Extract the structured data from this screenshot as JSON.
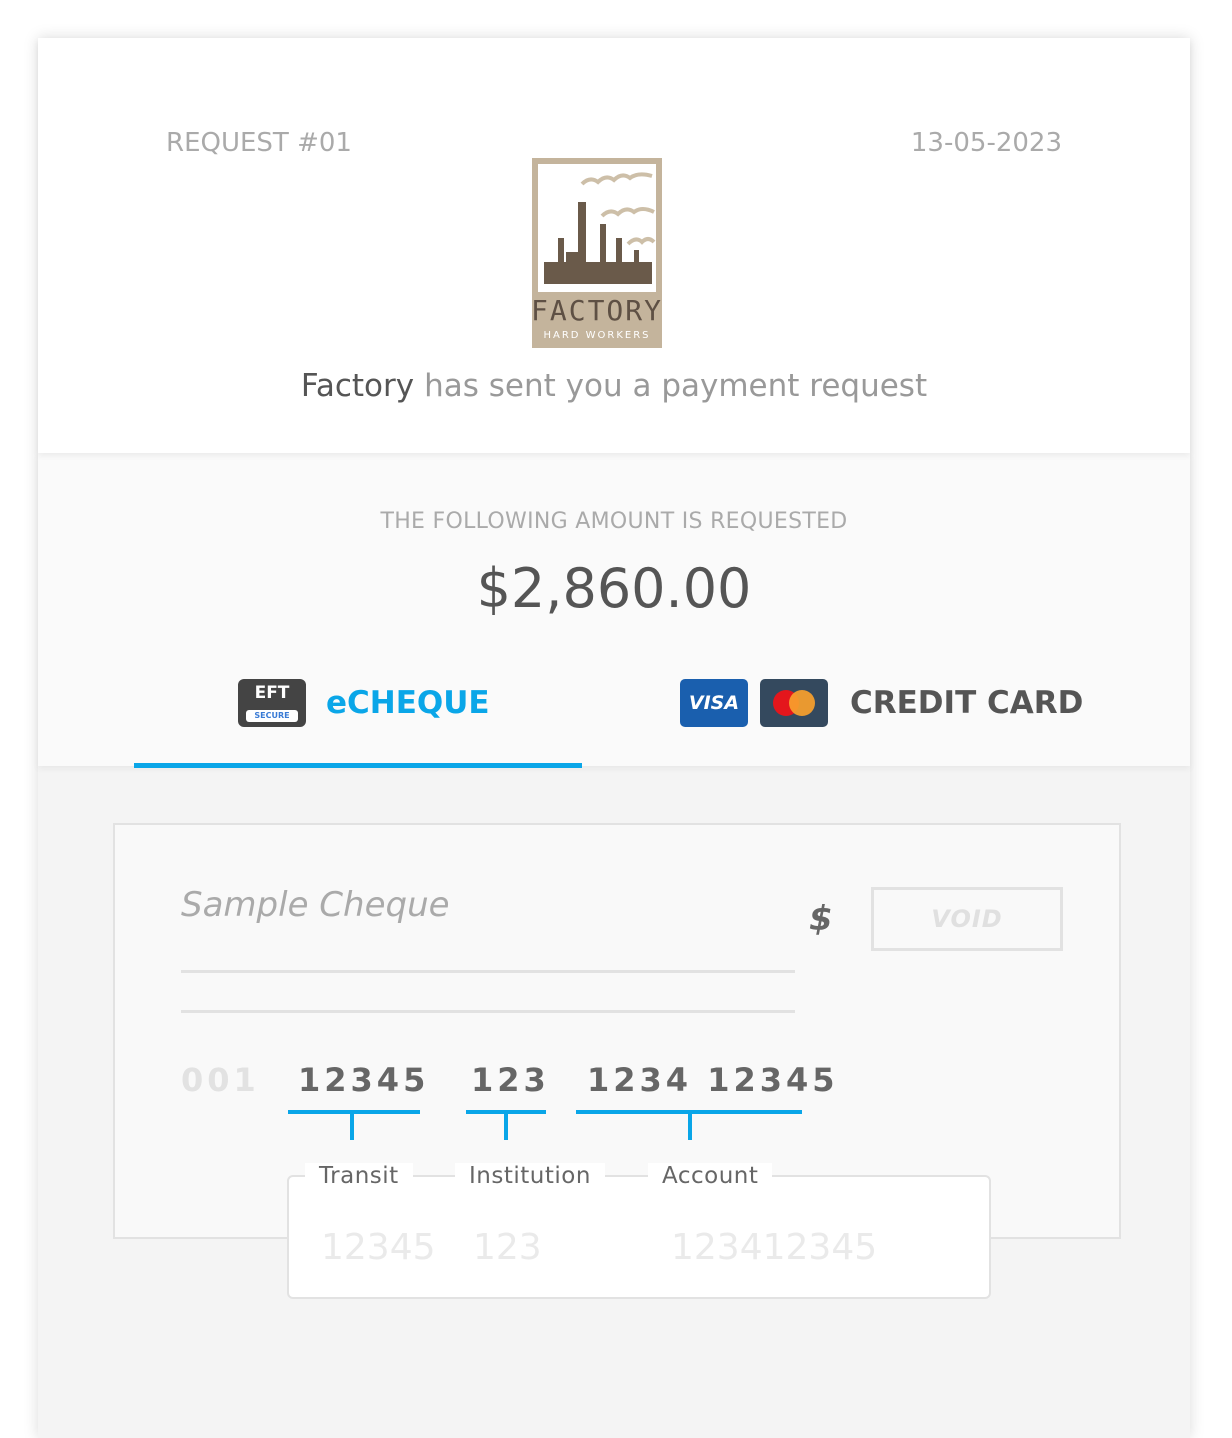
{
  "header": {
    "request_number": "REQUEST #01",
    "date": "13-05-2023",
    "logo": {
      "name": "FACTORY",
      "tagline": "HARD WORKERS",
      "color": "#c4b49c"
    },
    "sender": "Factory",
    "message": "has sent you a payment request"
  },
  "amount": {
    "label": "THE FOLLOWING AMOUNT IS REQUESTED",
    "value": "$2,860.00"
  },
  "tabs": [
    {
      "label": "eCHEQUE",
      "badge_top": "EFT",
      "badge_bottom": "SECURE",
      "active": true,
      "icon": "eft-secure-icon"
    },
    {
      "label": "CREDIT CARD",
      "visa_label": "VISA",
      "active": false,
      "icon": "visa-mastercard-icon"
    }
  ],
  "accent_color": "#0aa6e8",
  "cheque": {
    "title": "Sample Cheque",
    "currency_symbol": "$",
    "void_label": "VOID",
    "cheque_number": "001",
    "transit": "12345",
    "institution": "123",
    "account": "1234 12345"
  },
  "fields": {
    "transit": {
      "label": "Transit",
      "placeholder": "12345",
      "value": ""
    },
    "institution": {
      "label": "Institution",
      "placeholder": "123",
      "value": ""
    },
    "account": {
      "label": "Account",
      "placeholder": "123412345",
      "value": ""
    }
  }
}
